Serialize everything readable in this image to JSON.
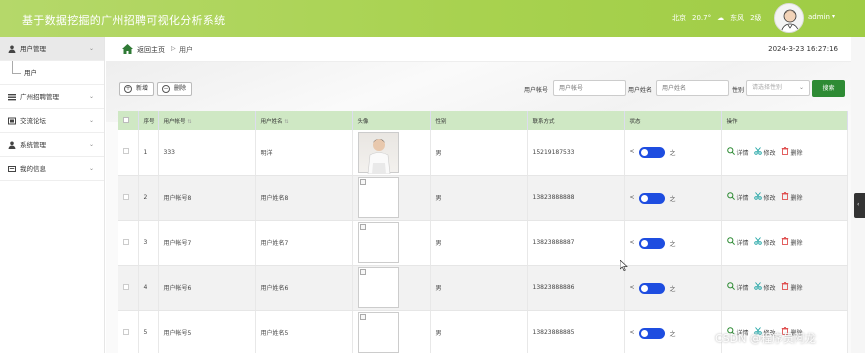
{
  "header": {
    "title": "基于数据挖掘的广州招聘可视化分析系统",
    "city": "北京",
    "temperature": "20.7°",
    "wind": "东风",
    "level": "2级",
    "username": "admin",
    "caret": "▾"
  },
  "sidebar": {
    "items": [
      {
        "label": "用户管理",
        "icon": "user-icon"
      },
      {
        "label": "广州招聘管理",
        "icon": "list-icon"
      },
      {
        "label": "交流论坛",
        "icon": "forum-icon"
      },
      {
        "label": "系统管理",
        "icon": "user-icon"
      },
      {
        "label": "我的信息",
        "icon": "card-icon"
      }
    ],
    "submenu": "用户"
  },
  "breadcrumb": {
    "home": "返回主页",
    "separator": "▷",
    "current": "用户",
    "datetime": "2024-3-23 16:27:16"
  },
  "toolbar": {
    "add_label": "新增",
    "delete_label": "删除",
    "account_label": "用户帐号",
    "account_placeholder": "用户帐号",
    "name_label": "用户姓名",
    "name_placeholder": "用户姓名",
    "gender_label": "性别",
    "gender_placeholder": "请选择性别",
    "search_label": "搜索"
  },
  "table": {
    "headers": [
      "序号",
      "用户帐号",
      "用户姓名",
      "头像",
      "性别",
      "联系方式",
      "状态",
      "操作"
    ],
    "rows": [
      {
        "index": "1",
        "account": "333",
        "name": "明洋",
        "gender": "男",
        "phone": "15219187533"
      },
      {
        "index": "2",
        "account": "用户帐号8",
        "name": "用户姓名8",
        "gender": "男",
        "phone": "13823888888"
      },
      {
        "index": "3",
        "account": "用户帐号7",
        "name": "用户姓名7",
        "gender": "男",
        "phone": "13823888887"
      },
      {
        "index": "4",
        "account": "用户帐号6",
        "name": "用户姓名6",
        "gender": "男",
        "phone": "13823888886"
      },
      {
        "index": "5",
        "account": "用户帐号5",
        "name": "用户姓名5",
        "gender": "男",
        "phone": "13823888885"
      }
    ],
    "toggle_left": "<",
    "toggle_right": "之",
    "ops": {
      "detail": "详情",
      "edit": "修改",
      "delete": "删除"
    }
  },
  "watermark": "CSDN @程序员阿龙",
  "colors": {
    "header": "#a8d24f",
    "table_header": "#cfe8c4",
    "search_btn": "#2e8b34",
    "toggle": "#1e4de0"
  }
}
